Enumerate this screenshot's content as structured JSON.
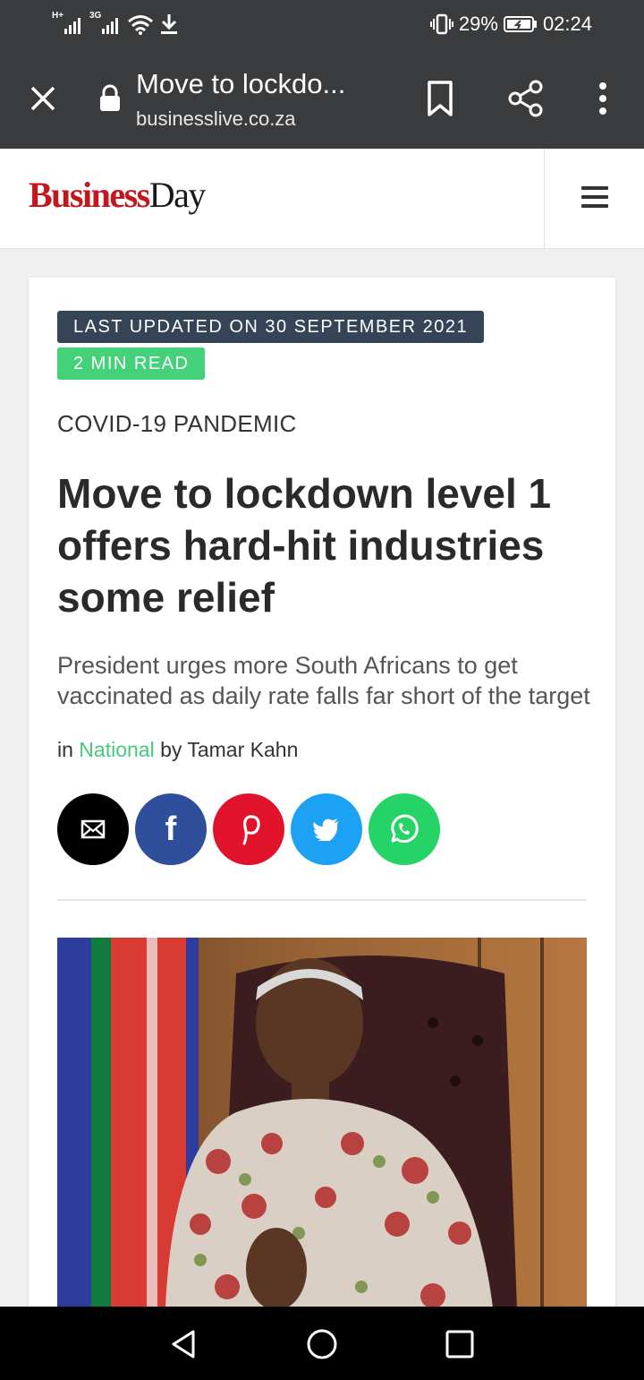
{
  "status_bar": {
    "network_1": "H+",
    "network_2": "3G",
    "battery": "29%",
    "time": "02:24"
  },
  "browser": {
    "page_title": "Move to lockdo...",
    "url": "businesslive.co.za",
    "icons": [
      "close-icon",
      "lock-icon",
      "bookmark-icon",
      "share-icon",
      "more-vert-icon"
    ]
  },
  "site": {
    "logo_part1": "Business",
    "logo_part2": "Day",
    "brand_color": "#c4161c"
  },
  "article": {
    "updated_badge": "LAST UPDATED ON 30 SEPTEMBER 2021",
    "read_time_badge": "2 MIN READ",
    "category": "COVID-19 PANDEMIC",
    "headline": "Move to lockdown level 1 offers hard-hit industries some relief",
    "standfirst": "President urges more South Africans to get vaccinated as daily rate falls far short of the target",
    "byline_in": "in",
    "byline_section": "National",
    "byline_by": "by",
    "byline_author": "Tamar Kahn",
    "accent_color": "#45d07a",
    "badge_color": "#354557"
  },
  "share_buttons": {
    "facebook_glyph": "f",
    "pinterest_glyph": "P",
    "colors": {
      "email": "#000000",
      "facebook": "#2f4f9c",
      "pinterest": "#e0132a",
      "twitter": "#1da1f2",
      "whatsapp": "#25d366"
    }
  }
}
